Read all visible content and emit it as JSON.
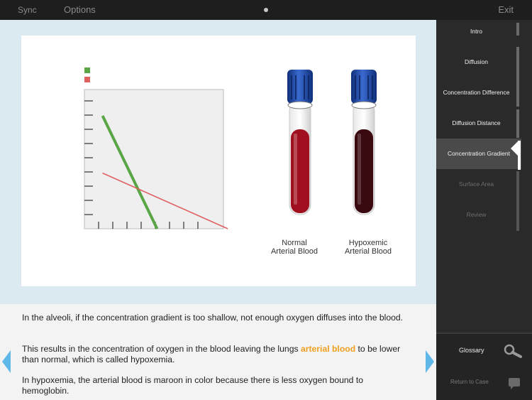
{
  "topbar": {
    "sync": "Sync",
    "options": "Options",
    "exit": "Exit"
  },
  "sidebar": {
    "items": [
      {
        "label": "Intro",
        "state": "normal"
      },
      {
        "label": "Diffusion",
        "state": "normal"
      },
      {
        "label": "Concentration Difference",
        "state": "normal"
      },
      {
        "label": "Diffusion Distance",
        "state": "normal"
      },
      {
        "label": "Concentration Gradient",
        "state": "active"
      },
      {
        "label": "Surface Area",
        "state": "dim"
      },
      {
        "label": "Review",
        "state": "dim"
      }
    ],
    "glossary": "Glossary",
    "return_to_case": "Return to Case"
  },
  "tubes": {
    "normal_label_line1": "Normal",
    "normal_label_line2": "Arterial Blood",
    "hypoxemic_label_line1": "Hypoxemic",
    "hypoxemic_label_line2": "Arterial Blood",
    "normal_color": "#a0101e",
    "hypoxemic_color": "#3a0a10",
    "cap_color": "#1a4aa8"
  },
  "text": {
    "p1": "In the alveoli, if the concentration gradient is too shallow, not enough oxygen diffuses into the blood.",
    "p2_before": "This results in the concentration of oxygen in the blood leaving the lungs ",
    "p2_highlight": "arterial blood",
    "p2_after": " to be lower than normal, which is called hypoxemia.",
    "p3": "In hypoxemia, the arterial blood is maroon in color because there is less oxygen bound to hemoglobin."
  },
  "colors": {
    "accent": "#f0a020",
    "nav_arrow": "#5fb8e8"
  },
  "chart_data": {
    "type": "line",
    "title": "",
    "xlabel": "",
    "ylabel": "",
    "xlim": [
      0,
      9
    ],
    "ylim": [
      0,
      9
    ],
    "grid": false,
    "legend": "top-left",
    "series": [
      {
        "color": "#5aa646",
        "x": [
          0.35,
          3.9
        ],
        "y": [
          7.3,
          0
        ]
      },
      {
        "color": "#e06060",
        "x": [
          0.35,
          8.5
        ],
        "y": [
          3.6,
          0
        ]
      }
    ]
  }
}
